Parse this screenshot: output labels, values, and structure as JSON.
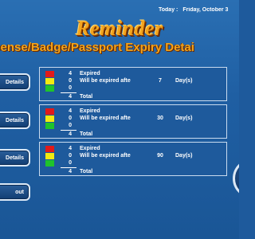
{
  "header": {
    "today_label": "Today :",
    "today_value": "Friday, October 3"
  },
  "title": "Reminder",
  "subtitle": "icense/Badge/Passport Expiry Detai",
  "nav": [
    {
      "label": "Details"
    },
    {
      "label": "Details"
    },
    {
      "label": "Details"
    },
    {
      "label": "out"
    }
  ],
  "panels": [
    {
      "expired_count": "4",
      "will_expire_count": "0",
      "other_count": "0",
      "total_count": "4",
      "expired_label": "Expired",
      "will_expire_label": "Will be expired afte",
      "days_value": "7",
      "days_unit": "Day(s)",
      "total_label": "Total"
    },
    {
      "expired_count": "4",
      "will_expire_count": "0",
      "other_count": "0",
      "total_count": "4",
      "expired_label": "Expired",
      "will_expire_label": "Will be expired afte",
      "days_value": "30",
      "days_unit": "Day(s)",
      "total_label": "Total"
    },
    {
      "expired_count": "4",
      "will_expire_count": "0",
      "other_count": "0",
      "total_count": "4",
      "expired_label": "Expired",
      "will_expire_label": "Will be expired afte",
      "days_value": "90",
      "days_unit": "Day(s)",
      "total_label": "Total"
    }
  ],
  "colors": {
    "background": "#1e5a9c",
    "title": "#f3a51e",
    "status_red": "#e21a1a",
    "status_yellow": "#f2ea11",
    "status_green": "#1fc32b"
  }
}
